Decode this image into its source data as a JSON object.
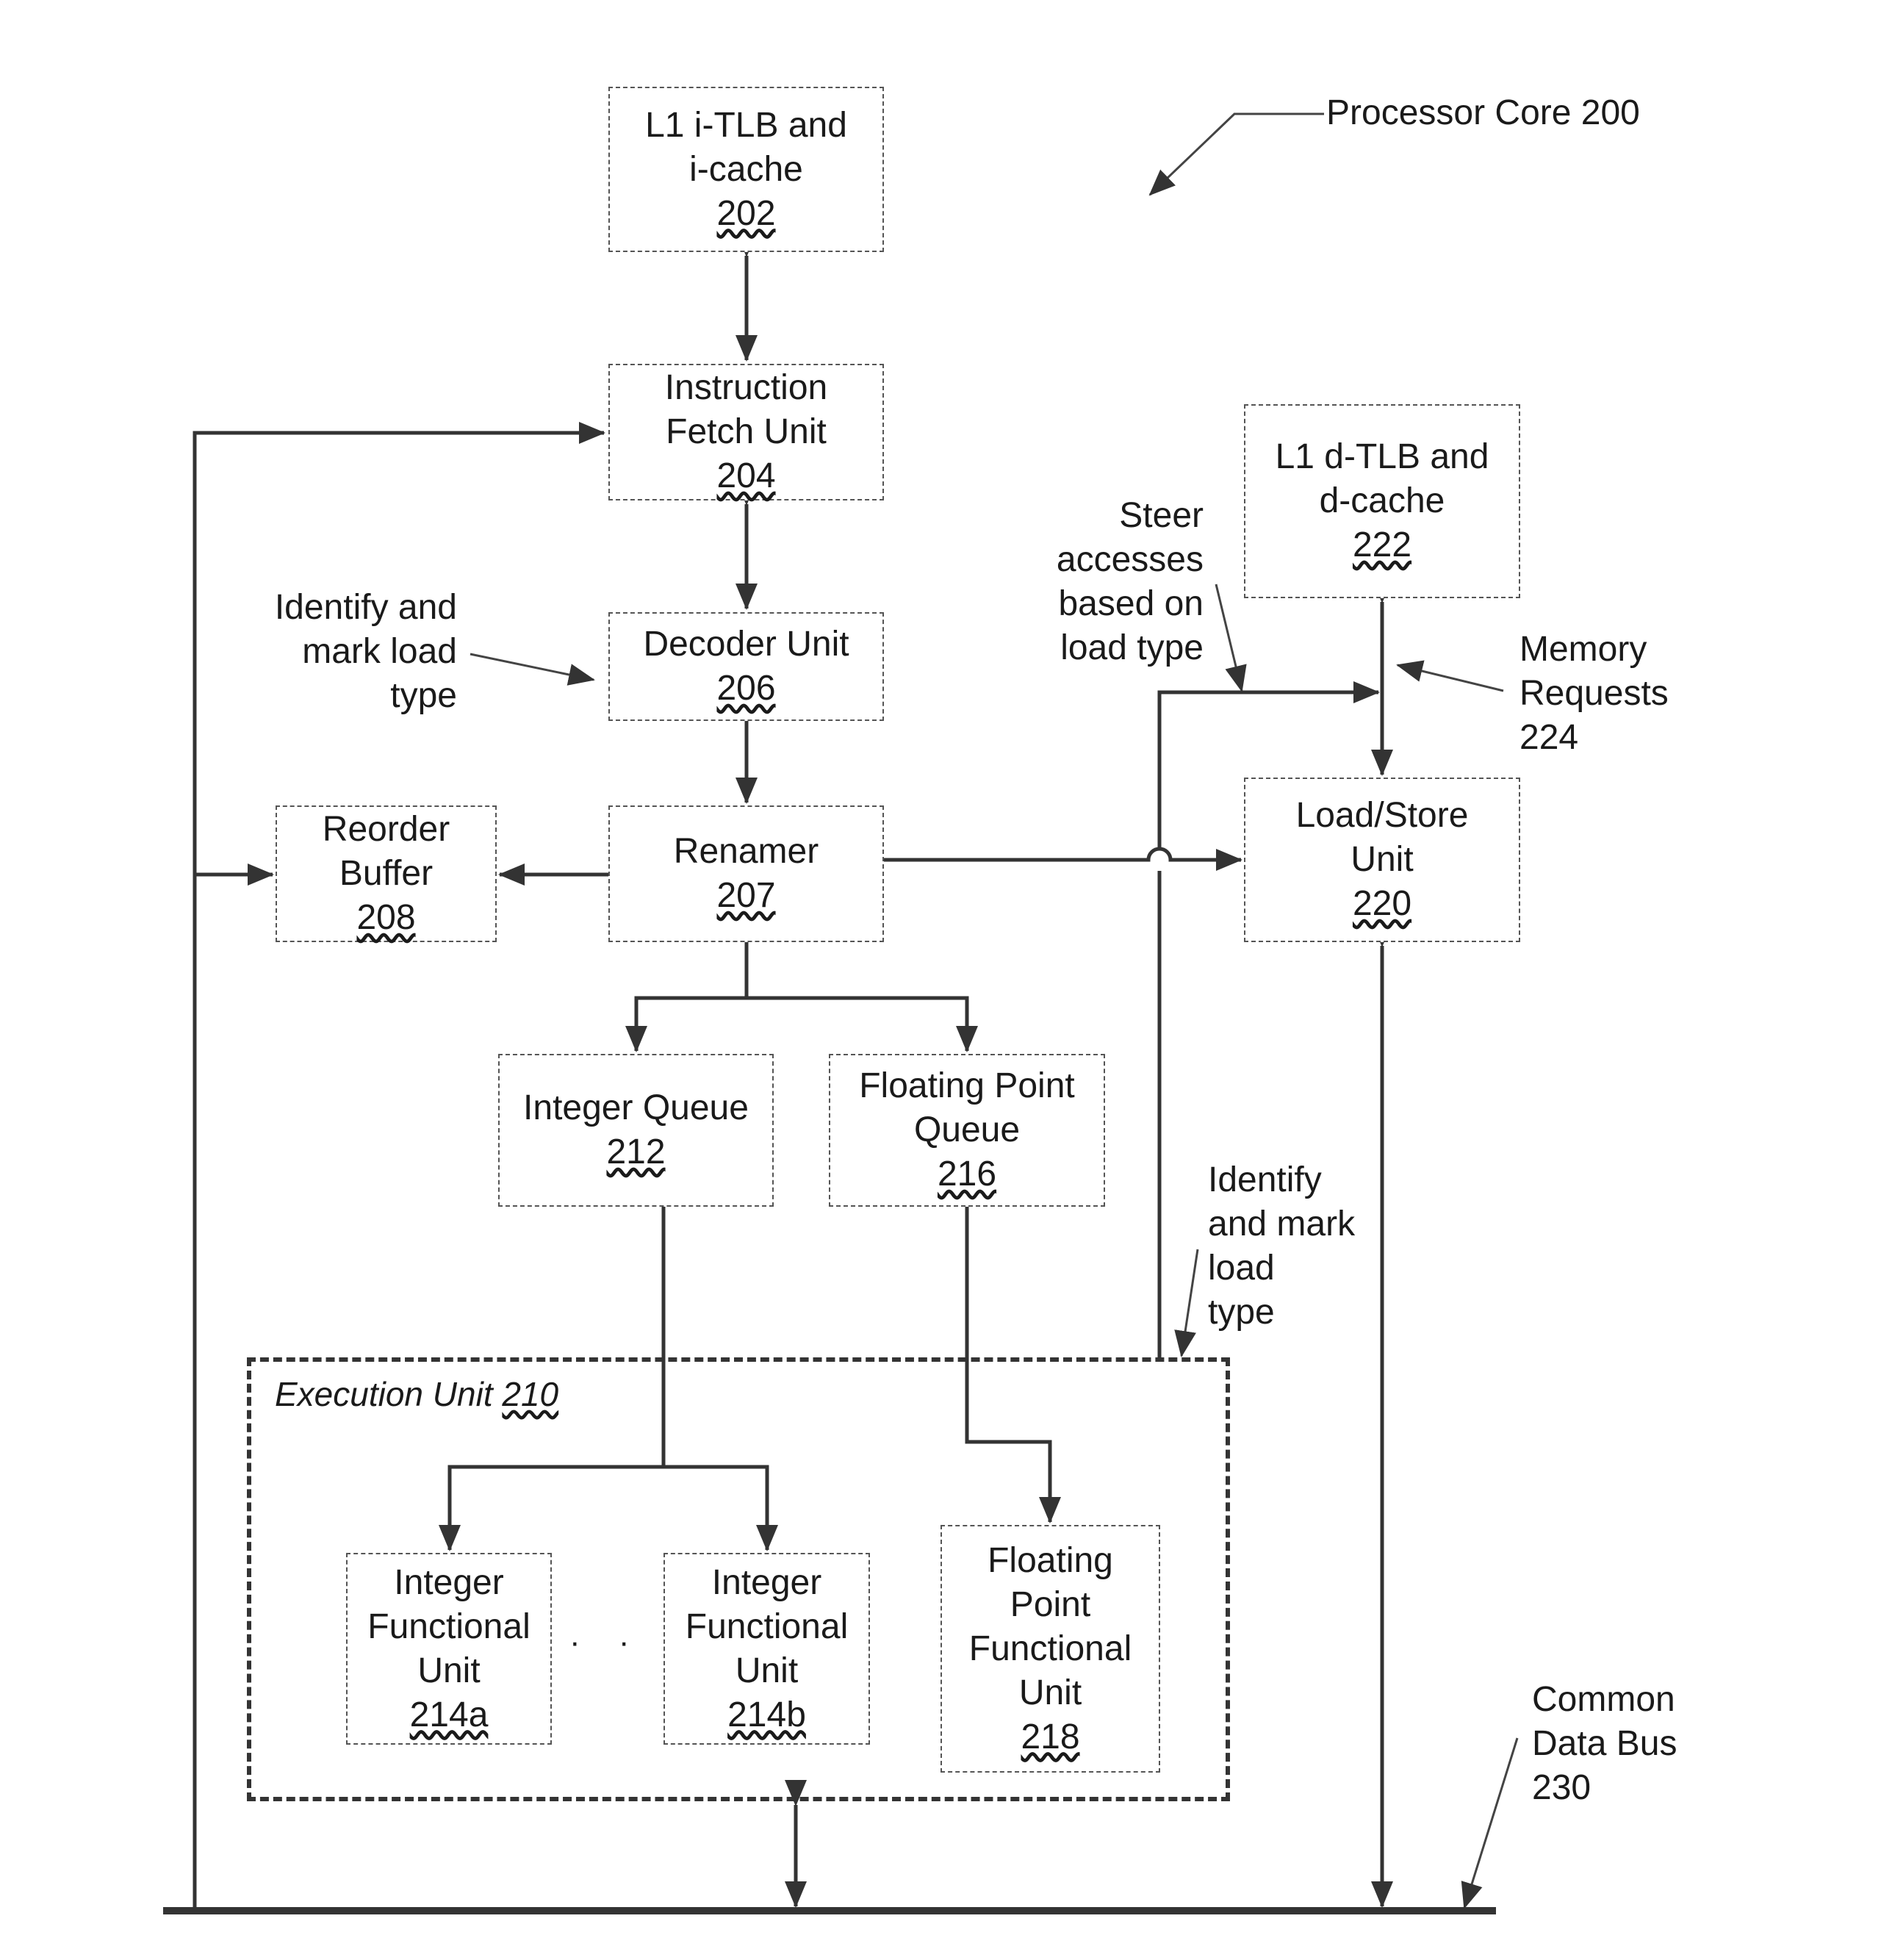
{
  "title": "Processor Core 200",
  "blocks": {
    "itlb": {
      "name": "L1 i-TLB and i-cache",
      "line1": "L1 i-TLB and",
      "line2": "i-cache",
      "ref": "202"
    },
    "ifu": {
      "line1": "Instruction",
      "line2": "Fetch Unit",
      "ref": "204"
    },
    "decoder": {
      "line1": "Decoder Unit",
      "ref": "206"
    },
    "renamer": {
      "line1": "Renamer",
      "ref": "207"
    },
    "rob": {
      "line1": "Reorder",
      "line2": "Buffer",
      "ref": "208"
    },
    "dtlb": {
      "line1": "L1 d-TLB and",
      "line2": "d-cache",
      "ref": "222"
    },
    "lsu": {
      "line1": "Load/Store",
      "line2": "Unit",
      "ref": "220"
    },
    "intq": {
      "line1": "Integer Queue",
      "ref": "212"
    },
    "fpq": {
      "line1": "Floating Point",
      "line2": "Queue",
      "ref": "216"
    },
    "ifu_a": {
      "line1": "Integer",
      "line2": "Functional",
      "line3": "Unit",
      "ref": "214a"
    },
    "ifu_b": {
      "line1": "Integer",
      "line2": "Functional",
      "line3": "Unit",
      "ref": "214b"
    },
    "fpfu": {
      "line1": "Floating",
      "line2": "Point",
      "line3": "Functional",
      "line4": "Unit",
      "ref": "218"
    }
  },
  "execution_unit": {
    "label": "Execution Unit",
    "ref": "210"
  },
  "ellipsis": "· · ·",
  "annotations": {
    "identify_decoder": "Identify and\nmark load\ntype",
    "steer": "Steer\naccesses\nbased on\nload type",
    "memory_requests": "Memory\nRequests\n224",
    "identify_exec": "Identify\nand mark\nload\ntype",
    "common_data_bus": "Common\nData Bus\n230"
  }
}
